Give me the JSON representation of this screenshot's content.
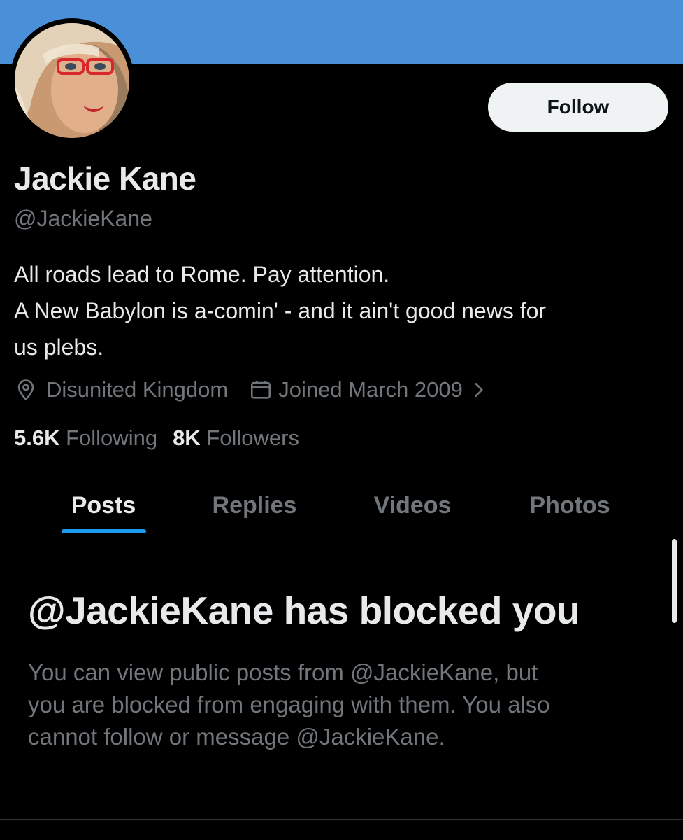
{
  "profile": {
    "name": "Jackie Kane",
    "handle": "@JackieKane",
    "bio_lines": [
      "All roads lead to Rome. Pay attention.",
      "A New Babylon is a-comin' - and it ain't good news for",
      "us plebs."
    ],
    "location": "Disunited Kingdom",
    "joined": "Joined March 2009",
    "following_count": "5.6K",
    "following_label": "Following",
    "followers_count": "8K",
    "followers_label": "Followers"
  },
  "actions": {
    "follow_label": "Follow"
  },
  "tabs": [
    {
      "label": "Posts",
      "active": true
    },
    {
      "label": "Replies",
      "active": false
    },
    {
      "label": "Videos",
      "active": false
    },
    {
      "label": "Photos",
      "active": false
    }
  ],
  "blocked": {
    "title": "@JackieKane has blocked you",
    "message_lines": [
      "You can view public posts from @JackieKane, but",
      "you are blocked from engaging with them. You also",
      "cannot follow or message @JackieKane."
    ]
  },
  "icons": {
    "location": "location-pin-icon",
    "calendar": "calendar-icon",
    "chevron": "chevron-right-icon"
  },
  "colors": {
    "banner": "#4a90d9",
    "accent": "#1d9bf0",
    "background": "#000000",
    "primary_text": "#e7e9ea",
    "secondary_text": "#71767b"
  }
}
